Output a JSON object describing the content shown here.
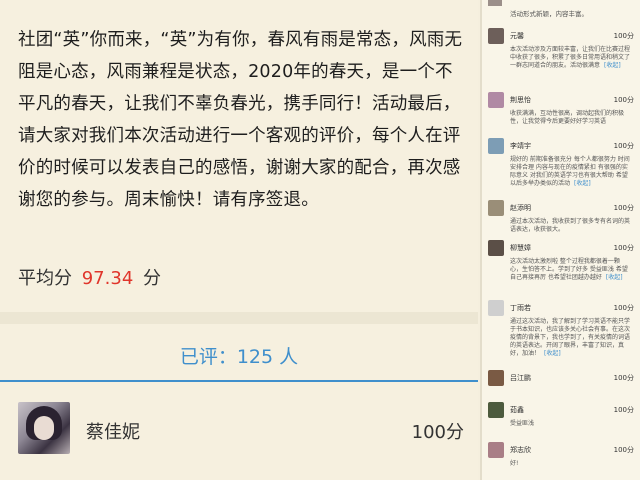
{
  "left": {
    "summary": "社团“英”你而来，“英”为有你，春风有雨是常态，风雨无阻是心态，风雨兼程是状态，2020年的春天，是一个不平凡的春天，让我们不辜负春光，携手同行！活动最后，请大家对我们本次活动进行一个客观的评价，每个人在评价的时候可以发表自己的感悟，谢谢大家的配合，再次感谢您的参与。周末愉快！请有序签退。",
    "avg_label": "平均分",
    "avg_score": "97.34",
    "avg_unit": "分",
    "rated_label": "已评：125 人",
    "entry": {
      "name": "蔡佳妮",
      "score": "100分"
    }
  },
  "right": {
    "top": {
      "text": "活动形式新颖，内容丰富。"
    },
    "expand_label": "[收起]",
    "entries": [
      {
        "name": "元馨",
        "score": "100分",
        "text": "本次活动涉及方面较丰富，让我们在比赛过程中收获了很多，积累了很多日常用语和稍文了一群志同道合的朋友。活动很满意",
        "more": true
      },
      {
        "name": "荆思怡",
        "score": "100分",
        "text": "收获满满，互动性很高，调动起我们的积极性，让我觉得今后更要好好学习英语",
        "more": false
      },
      {
        "name": "李靖宇",
        "score": "100分",
        "text": "规好的 前期准备很充分 每个人都很努力 时间安排合理 内容与现在的疫情紧扣 有很强的实际意义 对我们的英语学习也有很大帮助 希望以后多举办类似的活动",
        "more": true
      },
      {
        "name": "赵添明",
        "score": "100分",
        "text": "通过本次活动，我收获到了很多专有名词的英语表达，收获很大。",
        "more": false
      },
      {
        "name": "柳慧嫜",
        "score": "100分",
        "text": "这次活动太激烈啦 整个过程我都很着一颗心，生怕答不上。学到了好多 受益匪浅 希望自己再接再厉 也希望社团越办越好",
        "more": true
      },
      {
        "name": "丁雨若",
        "score": "100分",
        "text": "通过这次活动，我了解到了学习英语不能只学于书本知识，也应该多关心社会有事。在这次疫情的背景下，我也学到了，有关疫情的词语的英语表达。开阔了眼界，丰富了知识，真好，加油！",
        "more": true
      },
      {
        "name": "吕江鹏",
        "score": "100分",
        "text": "",
        "more": false
      },
      {
        "name": "茹鑫",
        "score": "100分",
        "text": "受益匪浅",
        "more": false
      },
      {
        "name": "郑志欣",
        "score": "100分",
        "text": "好!",
        "more": false
      }
    ]
  }
}
